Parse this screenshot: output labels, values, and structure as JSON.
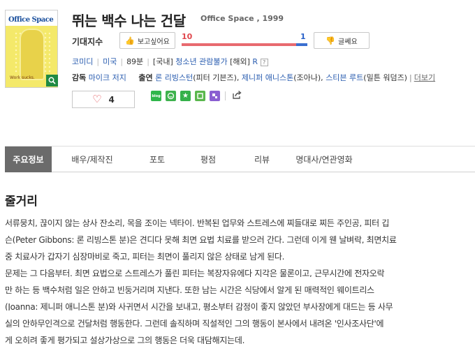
{
  "movie": {
    "title": "뛰는 백수 나는 건달",
    "original_title": "Office Space , 1999",
    "poster": {
      "title": "Office Space",
      "tagline": "Work sucks."
    }
  },
  "expectation": {
    "label": "기대지수",
    "want_label": "보고싶어요",
    "nowant_label": "글쎄요",
    "want_count": "10",
    "nowant_count": "1",
    "want_fraction": 0.909
  },
  "info": {
    "genre": "코미디",
    "country": "미국",
    "runtime": "89분",
    "rating_kr_label": "[국내]",
    "rating_kr": "청소년 관람불가",
    "rating_intl_label": "[해외]",
    "rating_intl": "R",
    "help": "?",
    "director_label": "감독",
    "director": "마이크 저지",
    "cast_label": "출연",
    "cast": [
      {
        "name": "론 리빙스턴",
        "role": "(피터 기븐즈),"
      },
      {
        "name": "제니퍼 애니스톤",
        "role": "(조아나),"
      },
      {
        "name": "스티븐 루트",
        "role": "(밀튼 워덤즈)"
      }
    ],
    "more": "더보기"
  },
  "like": {
    "count": "4"
  },
  "share": {
    "blog": "blog"
  },
  "tabs": [
    {
      "label": "주요정보",
      "active": true
    },
    {
      "label": "배우/제작진",
      "active": false
    },
    {
      "label": "포토",
      "active": false
    },
    {
      "label": "평점",
      "active": false
    },
    {
      "label": "리뷰",
      "active": false
    },
    {
      "label": "명대사/연관영화",
      "active": false
    }
  ],
  "synopsis": {
    "title": "줄거리",
    "lines": [
      "서류뭉치, 끊이지 않는 상사 잔소리, 목을 조이는 넥타이. 반복된 업무와 스트레스에 찌들대로 찌든 주인공, 피터 깁",
      "슨(Peter Gibbons: 론 리빙스톤 분)은 견디다 못해 최면 요법 치료를 받으러 간다. 그런데 이게 웬 날벼락, 최면치료",
      "중 치료사가 갑자기 심장마비로 죽고, 피터는 최면이 풀리지 않은 상태로 남게 된다.",
      "  문제는 그 다음부터. 최면 요법으로 스트레스가 풀린 피터는 복장자유에다 지각은 물론이고, 근무시간에 전자오락",
      "만 하는 등 백수처럼 일은 안하고 빈둥거리며 지낸다. 또한 남는 시간은 식당에서 알게 된 매력적인 웨이트리스",
      "(Joanna: 제니퍼 애니스톤 분)와 사귀면서 시간을 보내고, 평소부터 감정이 좋지 않았던 부사장에게 대드는 등 사무",
      "실의 안하무인격으로 건달처럼 행동한다. 그런데 솔직하며 직설적인 그의 행동이 본사에서 내려온 '인사조사단'에",
      "게 오히려 좋게 평가되고 설상가상으로 그의 행동은 더욱 대담해지는데."
    ]
  }
}
